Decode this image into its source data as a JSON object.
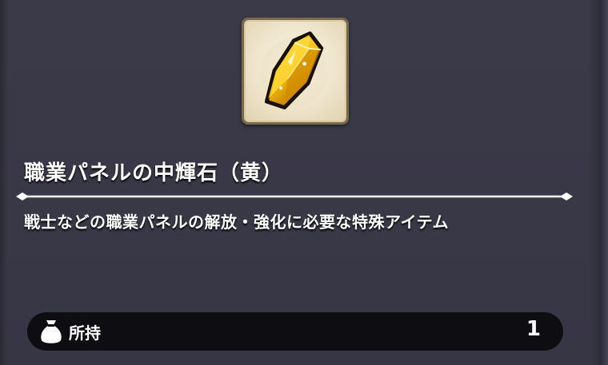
{
  "item": {
    "icon": "golden-crystal-icon",
    "name": "職業パネルの中輝石（黄）",
    "description": "戦士などの職業パネルの解放・強化に必要な特殊アイテム"
  },
  "inventory": {
    "icon": "money-bag-icon",
    "label": "所持",
    "count": "1"
  },
  "colors": {
    "background": "#3a3947",
    "crystal": "#f2b70c",
    "owned_bar": "#0d0d12"
  }
}
